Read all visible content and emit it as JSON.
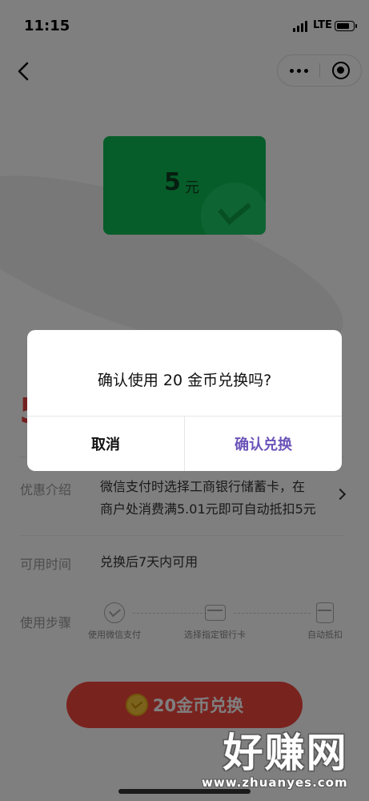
{
  "status_bar": {
    "time": "11:15",
    "network": "LTE"
  },
  "coupon": {
    "amount": "5",
    "unit": "元",
    "color": "#0fba55"
  },
  "details": {
    "price_glyph": "5",
    "intro": {
      "label": "优惠介绍",
      "line1": "微信支付时选择工商银行储蓄卡，在",
      "line2": "商户处消费满5.01元即可自动抵扣5元"
    },
    "time": {
      "label": "可用时间",
      "value": "兑换后7天内可用"
    },
    "steps": {
      "label": "使用步骤",
      "items": [
        "使用微信支付",
        "选择指定银行卡",
        "自动抵扣"
      ]
    }
  },
  "exchange_button": {
    "label": "20金币兑换",
    "color": "#f2463f"
  },
  "dialog": {
    "title": "确认使用 20 金币兑换吗?",
    "cancel_label": "取消",
    "confirm_label": "确认兑换",
    "confirm_color": "#6b53b8"
  },
  "watermark": {
    "main": "好赚网",
    "url": "www.zhuanyes.com"
  },
  "icons": {
    "back": "chevron-left-icon",
    "more": "more-dots-icon",
    "close": "target-close-icon",
    "arrow": "chevron-right-icon",
    "coin": "gold-coin-icon"
  }
}
